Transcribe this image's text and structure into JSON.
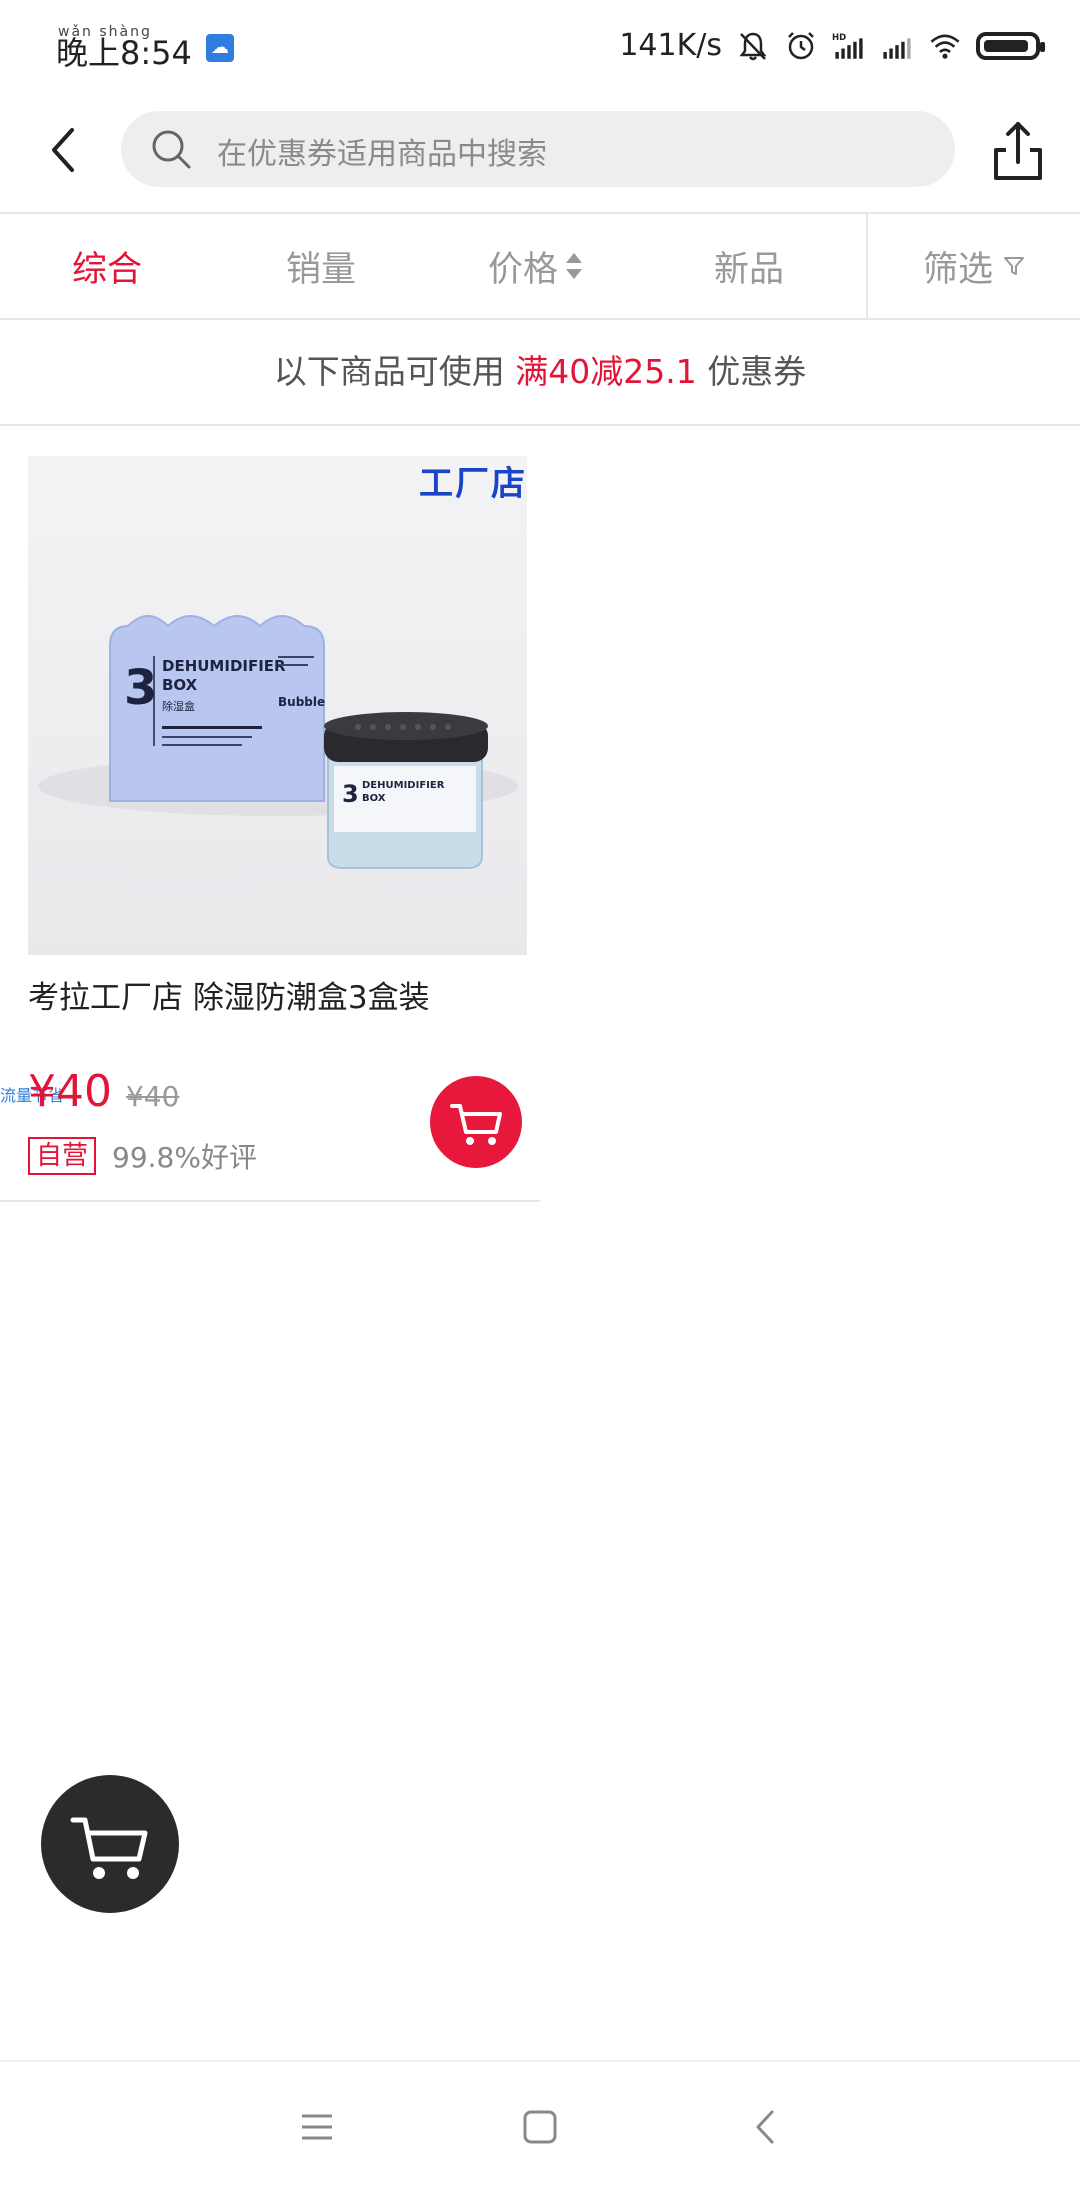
{
  "status_bar": {
    "time": "晚上8:54",
    "pinyin": "wǎn shàng",
    "network_speed": "141K/s",
    "icons": [
      "cloud-icon",
      "bell-off-icon",
      "alarm-icon",
      "hd-signal-icon",
      "signal-icon",
      "wifi-icon",
      "battery-icon"
    ]
  },
  "header": {
    "search_placeholder": "在优惠券适用商品中搜索"
  },
  "sort_tabs": [
    {
      "label": "综合",
      "active": true
    },
    {
      "label": "销量",
      "active": false
    },
    {
      "label": "价格",
      "active": false
    },
    {
      "label": "新品",
      "active": false
    },
    {
      "label": "筛选",
      "active": false
    }
  ],
  "coupon": {
    "prefix": "以下商品可使用 ",
    "highlight": "满40减25.1",
    "suffix": " 优惠券"
  },
  "product": {
    "store_tag": "工厂店",
    "title": "考拉工厂店 除湿防潮盒3盒装",
    "price": "¥40",
    "original_price": "¥40",
    "overlay_text": "流量节省",
    "badge": "自营",
    "rating": "99.8%好评",
    "image_text": {
      "big_digit": "3",
      "name_line1": "DEHUMIDIFIER",
      "name_line2": "BOX",
      "cn_name": "除湿盒",
      "brand": "Bubble"
    }
  },
  "colors": {
    "accent": "#e31436",
    "cart_button": "#e8173c",
    "floating_cart": "#2b2b2b",
    "store_tag": "#1a44c8"
  }
}
